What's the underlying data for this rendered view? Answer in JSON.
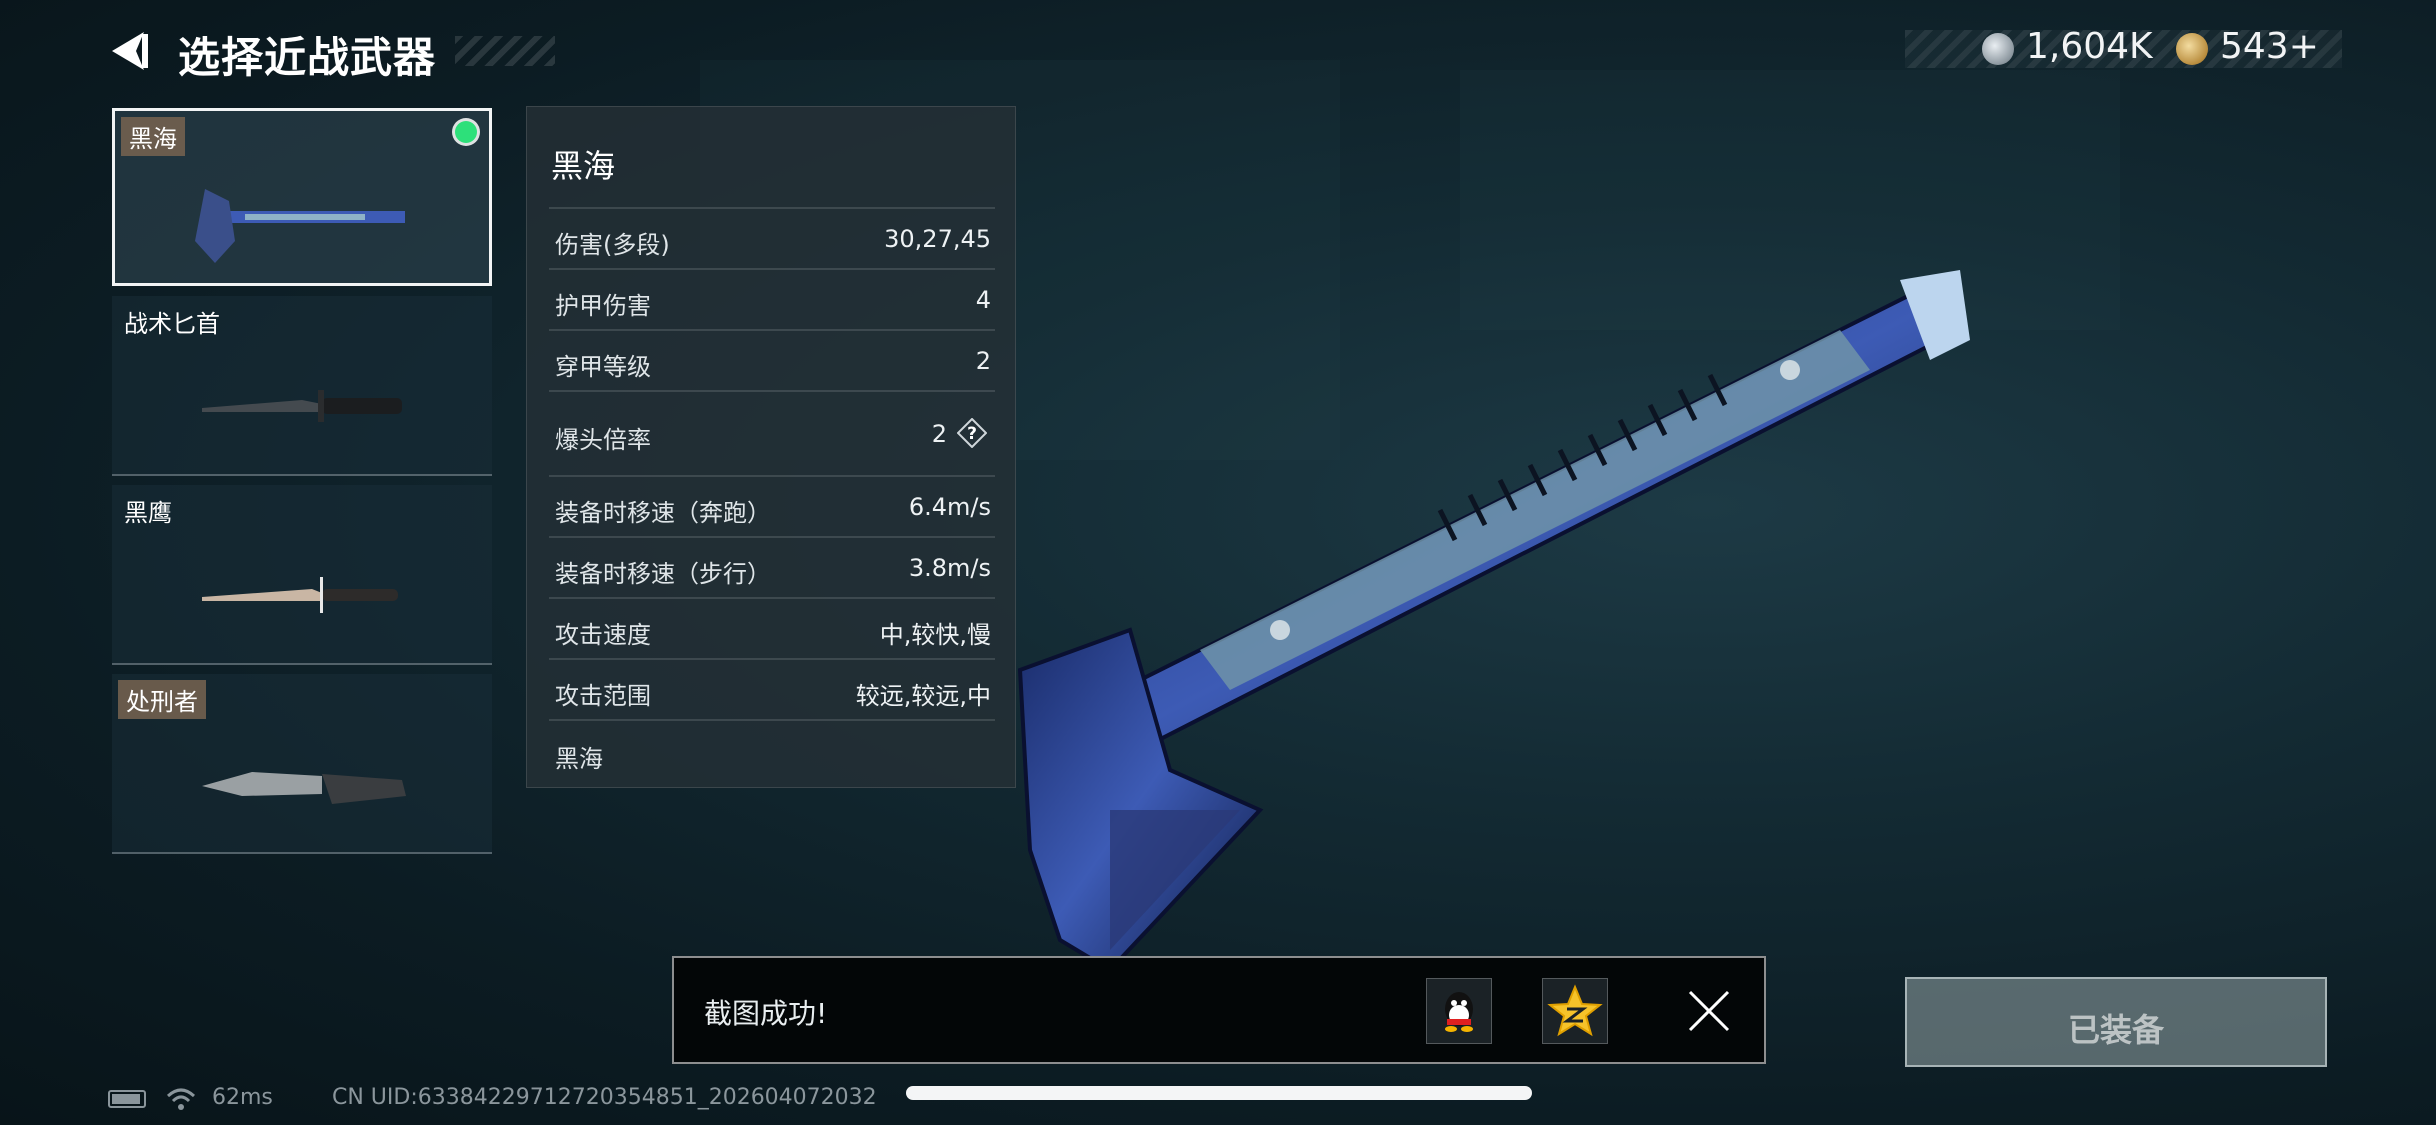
{
  "header": {
    "title": "选择近战武器",
    "currency": [
      {
        "icon": "silver-coin-icon",
        "value": "1,604K"
      },
      {
        "icon": "gold-coin-icon",
        "value": "543+"
      }
    ]
  },
  "weapons": [
    {
      "name": "黑海",
      "selected": true,
      "equipped": true,
      "tagged": true
    },
    {
      "name": "战术匕首",
      "selected": false,
      "equipped": false,
      "tagged": false
    },
    {
      "name": "黑鹰",
      "selected": false,
      "equipped": false,
      "tagged": false
    },
    {
      "name": "处刑者",
      "selected": false,
      "equipped": false,
      "tagged": true
    }
  ],
  "stats": {
    "title": "黑海",
    "rows": [
      {
        "label": "伤害(多段)",
        "value": "30,27,45"
      },
      {
        "label": "护甲伤害",
        "value": "4"
      },
      {
        "label": "穿甲等级",
        "value": "2"
      },
      {
        "label": "爆头倍率",
        "value": "2"
      },
      {
        "label": "装备时移速（奔跑）",
        "value": "6.4m/s"
      },
      {
        "label": "装备时移速（步行）",
        "value": "3.8m/s"
      },
      {
        "label": "攻击速度",
        "value": "中,较快,慢"
      },
      {
        "label": "攻击范围",
        "value": "较远,较远,中"
      }
    ],
    "footer": "黑海"
  },
  "toast": {
    "message": "截图成功!",
    "share_icons": [
      "qq-icon",
      "qzone-icon"
    ]
  },
  "equip_button": {
    "label": "已装备"
  },
  "status": {
    "ping": "62ms",
    "uid": "CN UID:6338422971272035485​1_202604072032"
  },
  "colors": {
    "equipped_dot": "#2de07a",
    "background": "#0c1c23"
  }
}
